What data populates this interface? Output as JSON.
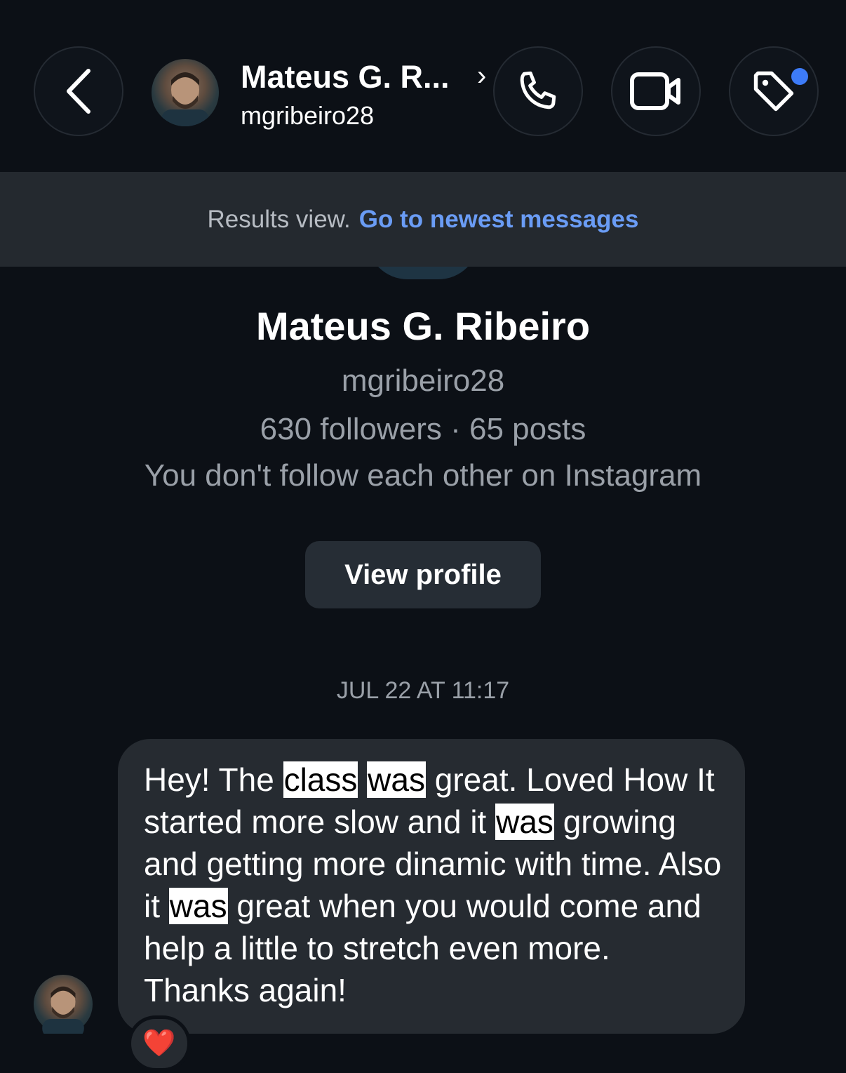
{
  "header": {
    "display_name": "Mateus G. R...",
    "chevron": "›",
    "username": "mgribeiro28",
    "icons": {
      "back": "chevron-left-icon",
      "call": "phone-icon",
      "video": "video-camera-icon",
      "tag": "tag-icon"
    },
    "tag_notification_dot": true,
    "accent_color": "#3d7bf7"
  },
  "banner": {
    "prefix": "Results view.",
    "link": "Go to newest messages"
  },
  "profile": {
    "name": "Mateus G. Ribeiro",
    "username": "mgribeiro28",
    "stats": "630 followers · 65 posts",
    "relationship": "You don't follow each other on Instagram",
    "view_button": "View profile"
  },
  "conversation": {
    "timestamp": "JUL 22 AT 11:17",
    "message": {
      "segments": [
        {
          "text": "Hey! The "
        },
        {
          "text": "class",
          "highlight": true
        },
        {
          "text": " "
        },
        {
          "text": "was",
          "highlight": true
        },
        {
          "text": " great. Loved How It started more slow and it "
        },
        {
          "text": "was",
          "highlight": true
        },
        {
          "text": " growing and getting more dinamic with time. Also it "
        },
        {
          "text": "was",
          "highlight": true
        },
        {
          "text": " great when you would come and help a little to stretch even more. Thanks again!"
        }
      ],
      "reaction": "❤️"
    }
  }
}
